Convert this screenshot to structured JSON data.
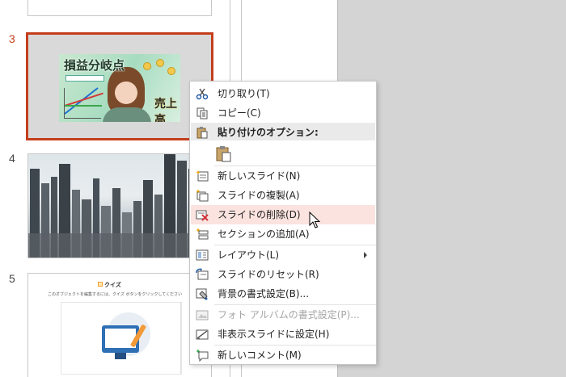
{
  "slides": [
    {
      "number": "3",
      "title": "損益分岐点",
      "subtitle": "売上高",
      "selected": true
    },
    {
      "number": "4"
    },
    {
      "number": "5",
      "heading": "クイズ",
      "text": "このオブジェクトを編集するには、クイズ ボタンをクリックしてください"
    }
  ],
  "menu": {
    "items": [
      {
        "label": "切り取り(T)",
        "icon": "scissors-icon"
      },
      {
        "label": "コピー(C)",
        "icon": "copy-icon"
      },
      {
        "label": "貼り付けのオプション:",
        "icon": "paste-icon"
      },
      {
        "label": "",
        "icon": "paste-keep-source-icon"
      },
      {
        "label": "新しいスライド(N)",
        "icon": "new-slide-icon"
      },
      {
        "label": "スライドの複製(A)",
        "icon": "duplicate-slide-icon"
      },
      {
        "label": "スライドの削除(D)",
        "icon": "delete-slide-icon"
      },
      {
        "label": "セクションの追加(A)",
        "icon": "add-section-icon"
      },
      {
        "label": "レイアウト(L)",
        "icon": "layout-icon"
      },
      {
        "label": "スライドのリセット(R)",
        "icon": "reset-slide-icon"
      },
      {
        "label": "背景の書式設定(B)...",
        "icon": "format-background-icon"
      },
      {
        "label": "フォト アルバムの書式設定(P)...",
        "icon": "photo-album-icon"
      },
      {
        "label": "非表示スライドに設定(H)",
        "icon": "hide-slide-icon"
      },
      {
        "label": "新しいコメント(M)",
        "icon": "new-comment-icon"
      }
    ]
  },
  "colors": {
    "accent": "#c43e1c",
    "highlight": "#fbe3df"
  }
}
